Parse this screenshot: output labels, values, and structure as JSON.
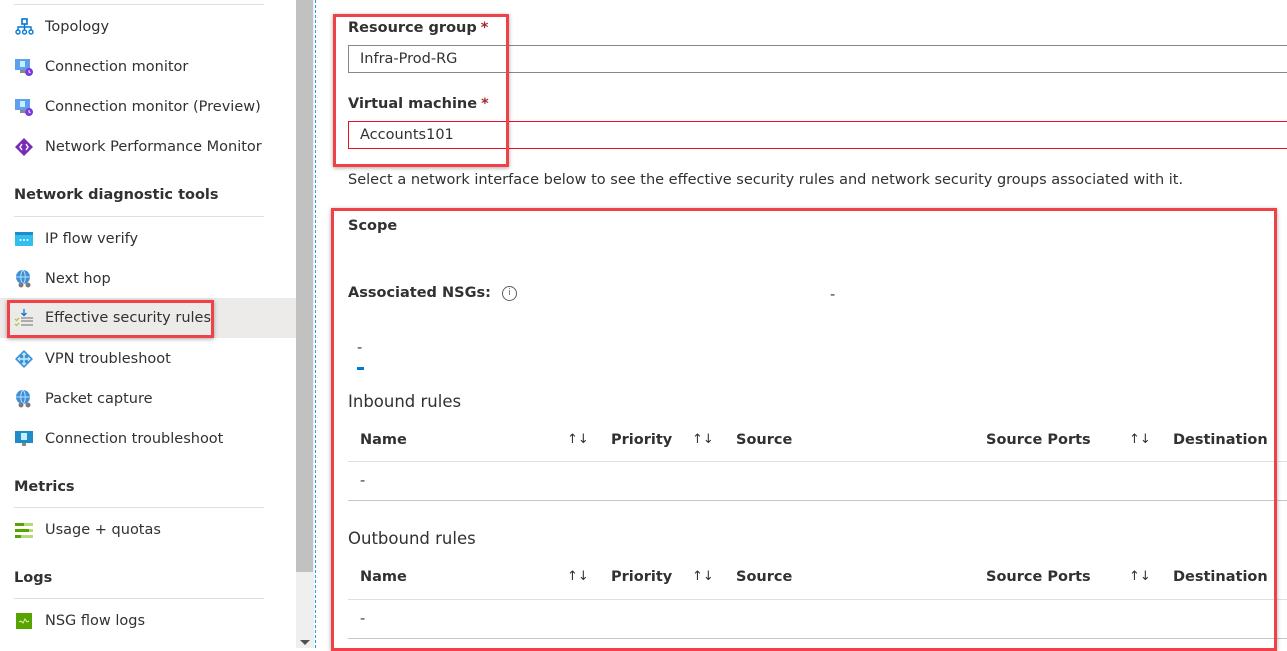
{
  "sidebar": {
    "items_top": [
      {
        "label": "Topology",
        "icon": "topology-icon"
      },
      {
        "label": "Connection monitor",
        "icon": "connection-monitor-icon"
      },
      {
        "label": "Connection monitor (Preview)",
        "icon": "connection-monitor-preview-icon"
      },
      {
        "label": "Network Performance Monitor",
        "icon": "network-performance-monitor-icon"
      }
    ],
    "sections": [
      {
        "title": "Network diagnostic tools",
        "items": [
          {
            "label": "IP flow verify",
            "icon": "ip-flow-verify-icon"
          },
          {
            "label": "Next hop",
            "icon": "next-hop-icon"
          },
          {
            "label": "Effective security rules",
            "icon": "effective-security-rules-icon",
            "active": true
          },
          {
            "label": "VPN troubleshoot",
            "icon": "vpn-troubleshoot-icon"
          },
          {
            "label": "Packet capture",
            "icon": "packet-capture-icon"
          },
          {
            "label": "Connection troubleshoot",
            "icon": "connection-troubleshoot-icon"
          }
        ]
      },
      {
        "title": "Metrics",
        "items": [
          {
            "label": "Usage + quotas",
            "icon": "usage-quotas-icon"
          }
        ]
      },
      {
        "title": "Logs",
        "items": [
          {
            "label": "NSG flow logs",
            "icon": "nsg-flow-logs-icon"
          }
        ]
      }
    ]
  },
  "form": {
    "resource_group": {
      "label": "Resource group",
      "required_mark": "*",
      "value": "Infra-Prod-RG"
    },
    "virtual_machine": {
      "label": "Virtual machine",
      "required_mark": "*",
      "value": "Accounts101"
    },
    "hint": "Select a network interface below to see the effective security rules and network security groups associated with it."
  },
  "scope": {
    "label": "Scope",
    "associated_nsgs_label": "Associated NSGs:",
    "associated_nsgs_value": "-",
    "interface_tab": "-"
  },
  "inbound": {
    "title": "Inbound rules",
    "columns": [
      "Name",
      "Priority",
      "Source",
      "Source Ports",
      "Destination"
    ],
    "rows": [
      [
        "-"
      ]
    ]
  },
  "outbound": {
    "title": "Outbound rules",
    "columns": [
      "Name",
      "Priority",
      "Source",
      "Source Ports",
      "Destination"
    ],
    "rows": [
      [
        "-"
      ]
    ]
  },
  "glyphs": {
    "sort": "↑↓",
    "info": "i"
  },
  "colors": {
    "highlight_box": "#f04048",
    "accent": "#0078d4",
    "error_border": "#e81123",
    "required": "#a4262c"
  }
}
